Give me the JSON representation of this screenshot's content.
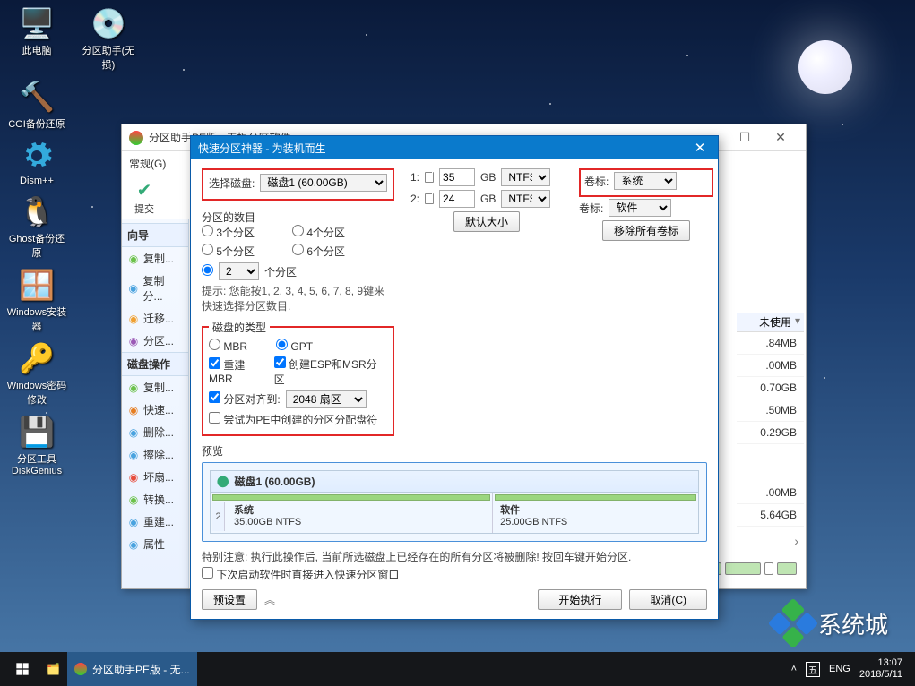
{
  "desktop": {
    "icons": [
      {
        "label": "此电脑",
        "glyph": "🖥️"
      },
      {
        "label": "分区助手(无损)",
        "glyph": "💿"
      },
      {
        "label": "CGI备份还原",
        "glyph": "🔨"
      },
      {
        "label": "Dism++",
        "glyph": "⚙️"
      },
      {
        "label": "Ghost备份还原",
        "glyph": "🐧"
      },
      {
        "label": "Windows安装器",
        "glyph": "🪟"
      },
      {
        "label": "Windows密码修改",
        "glyph": "🔑"
      },
      {
        "label": "分区工具DiskGenius",
        "glyph": "💾"
      }
    ]
  },
  "bgwin": {
    "title": "分区助手PE版 - 无损分区软件",
    "menu": "常规(G)",
    "submit": "提交",
    "sections": {
      "wizard": "向导",
      "diskops": "磁盘操作"
    },
    "wizard_items": [
      {
        "label": "复制...",
        "color": "#6cc24a"
      },
      {
        "label": "复制分...",
        "color": "#4aa3df"
      },
      {
        "label": "迁移...",
        "color": "#f0a030"
      },
      {
        "label": "分区...",
        "color": "#9b59b6"
      }
    ],
    "disk_items": [
      {
        "label": "复制...",
        "color": "#6cc24a"
      },
      {
        "label": "快速...",
        "color": "#e67e22"
      },
      {
        "label": "删除...",
        "color": "#4aa3df"
      },
      {
        "label": "擦除...",
        "color": "#4aa3df"
      },
      {
        "label": "坏扇...",
        "color": "#e74c3c"
      },
      {
        "label": "转换...",
        "color": "#6cc24a"
      },
      {
        "label": "重建...",
        "color": "#4aa3df"
      },
      {
        "label": "属性",
        "color": "#4aa3df"
      }
    ],
    "right_header": "未使用",
    "right_rows": [
      ".84MB",
      ".00MB",
      "0.70GB",
      ".50MB",
      "0.29GB",
      ".00MB",
      "5.64GB"
    ]
  },
  "modal": {
    "title": "快速分区神器 - 为装机而生",
    "select_disk": "选择磁盘:",
    "disk_value": "磁盘1 (60.00GB)",
    "part_count_title": "分区的数目",
    "r3": "3个分区",
    "r4": "4个分区",
    "r5": "5个分区",
    "r6": "6个分区",
    "custom_val": "2",
    "custom_suffix": "个分区",
    "hint": "提示: 您能按1, 2, 3, 4, 5, 6, 7, 8, 9键来快速选择分区数目.",
    "disk_type_title": "磁盘的类型",
    "mbr": "MBR",
    "gpt": "GPT",
    "rebuild": "重建MBR",
    "esp": "创建ESP和MSR分区",
    "align": "分区对齐到:",
    "align_val": "2048 扇区",
    "pe": "尝试为PE中创建的分区分配盘符",
    "rows": [
      {
        "n": "1:",
        "size": "35",
        "unit": "GB",
        "fs": "NTFS",
        "vlabel": "卷标:",
        "vval": "系统",
        "lock": true
      },
      {
        "n": "2:",
        "size": "24",
        "unit": "GB",
        "fs": "NTFS",
        "vlabel": "卷标:",
        "vval": "软件",
        "lock": true
      }
    ],
    "default_size": "默认大小",
    "remove_labels": "移除所有卷标",
    "preview": "预览",
    "disk_header": "磁盘1  (60.00GB)",
    "seg1_name": "系统",
    "seg1_size": "35.00GB NTFS",
    "seg2_name": "软件",
    "seg2_size": "25.00GB NTFS",
    "seg_num": "2",
    "warn": "特别注意: 执行此操作后, 当前所选磁盘上已经存在的所有分区将被删除!  按回车键开始分区.",
    "next_time": "下次启动软件时直接进入快速分区窗口",
    "preset": "预设置",
    "chev": "︽",
    "start": "开始执行",
    "cancel": "取消(C)"
  },
  "taskbar": {
    "app": "分区助手PE版 - 无...",
    "ime1": "五",
    "ime2": "ENG",
    "time": "13:07",
    "date": "2018/5/11"
  },
  "watermark": "系统城"
}
